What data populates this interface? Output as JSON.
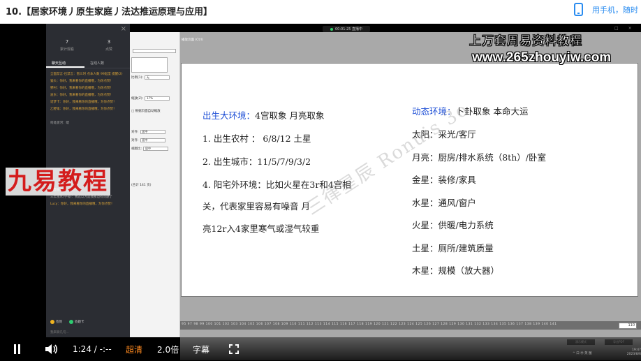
{
  "page": {
    "title": "10.【居家环境丿原生家庭丿法达推运原理与应用】",
    "mobile_link": "用手机，随时"
  },
  "chat": {
    "close": "×",
    "stats": [
      {
        "num": "7",
        "label": "累计观看"
      },
      {
        "num": "3",
        "label": "点赞"
      }
    ],
    "tabs": [
      "聊天互动",
      "在线人数"
    ],
    "messages": [
      {
        "text": "全面禁言-已禁言：暂三时 点本人数 99起度 提醒(2)",
        "style": "orange"
      },
      {
        "text": "猫头：你好，我来看你的直播哦，为你点赞！",
        "style": "orange"
      },
      {
        "text": "野村：你好，我来看你的直播哦，为你点赞！",
        "style": "orange"
      },
      {
        "text": "迪东：你好，我来看你的直播哦，为你点赞！",
        "style": "orange"
      },
      {
        "text": "诺梦卡：你好，我来看你的直播哦，为你点赞！",
        "style": "orange"
      },
      {
        "text": "乙野鬼：你好，我来看你的直播哦，为你点赞！",
        "style": "orange"
      },
      {
        "text": "何处渡河：嗯",
        "style": "grey"
      },
      {
        "text": "声音很小",
        "style": "white"
      },
      {
        "text": "三年浊水(学号)：我这以为是我那边有问题了",
        "style": "grey"
      },
      {
        "text": "Lucy：你好，我来看你的直播哦，为你点赞！",
        "style": "orange"
      }
    ],
    "chips": [
      {
        "label": "签到",
        "color": "#f0b420"
      },
      {
        "label": "答题卡",
        "color": "#2ecc71"
      }
    ],
    "input_hint": "我来聊几句..."
  },
  "settings": {
    "rows": [
      {
        "label": "",
        "value": ""
      },
      {
        "label": "",
        "value": ""
      },
      {
        "label": "比例(1):",
        "value": "无"
      },
      {
        "label": "缩放(Z):",
        "value": "17%"
      },
      {
        "label": "□ 根据页面自动缩放",
        "value": ""
      },
      {
        "label": "对齐:",
        "value": "居中"
      },
      {
        "label": "对齐:",
        "value": "居中"
      },
      {
        "label": "视图比:",
        "value": "居中"
      },
      {
        "label": "(合计 141 页)",
        "value": ""
      }
    ]
  },
  "watermarks": {
    "title": "上万套周易资料教程",
    "url": "www.265zhouyiw.com",
    "jiuyi": "九易教程",
    "diagonal": "三律星辰 Ronuis 3o"
  },
  "screen": {
    "recorder": "00:01:25  直播中",
    "window_controls": "□  ×",
    "slide_header": "播放页面 (Ctrl)",
    "ruler": "95 97 98 99 100 101 102 103 104 105 106 107 108 109 110 111 112 113 114 115 116 117 118 119 120 121 122 123 124 125 126 127 128 129 130 131 132 133 134 135 136 137 138 139 140 141",
    "page_box": "110",
    "bottom_buttons": [
      "演示模式",
      "导出PDF"
    ]
  },
  "slide": {
    "left": [
      {
        "label": "出生大环境：",
        "text": "4宫取象 月亮取象"
      },
      {
        "label": "",
        "text": "1. 出生农村 ： 6/8/12 土星"
      },
      {
        "label": "",
        "text": "2. 出生城市：11/5/7/9/3/2"
      },
      {
        "label": "",
        "text": "4. 阳宅外环境：比如火星在3r和4宫相"
      },
      {
        "label": "",
        "text": "关，代表家里容易有噪音 月"
      },
      {
        "label": "",
        "text": "亮12r入4家里寒气或湿气较重"
      }
    ],
    "right": [
      {
        "label": "动态环境：",
        "text": "卜卦取象 本命大运"
      },
      {
        "label": "",
        "text": "太阳：采光/客厅"
      },
      {
        "label": "",
        "text": "月亮：厨房/排水系统（8th）/卧室"
      },
      {
        "label": "",
        "text": "金星：装修/家具"
      },
      {
        "label": "",
        "text": "水星：通风/窗户"
      },
      {
        "label": "",
        "text": "火星：供暖/电力系统"
      },
      {
        "label": "",
        "text": "土星：厕所/建筑质量"
      },
      {
        "label": "",
        "text": "木星：规模（放大器）"
      }
    ]
  },
  "controls": {
    "time": "1:24 / -:--",
    "quality": "超清",
    "speed": "2.0倍",
    "subtitle": "字幕",
    "taskbar_right": "^ 口 ㊥ 英 图",
    "taskbar_time": "19:47 2023/8/6"
  },
  "colors": {
    "accent": "#2a8cf0",
    "slide_blue": "#1e4fd6",
    "quality_orange": "#ff8a1f",
    "watermark_red": "#d41c1c"
  }
}
